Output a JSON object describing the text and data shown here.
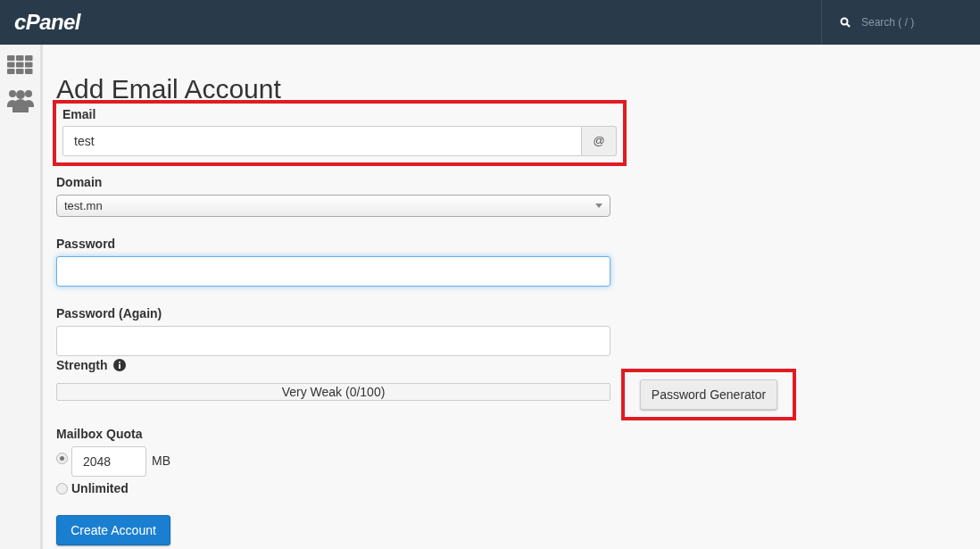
{
  "header": {
    "logo": "cPanel",
    "search": {
      "placeholder": "Search ( / )"
    }
  },
  "page_title": "Add Email Account",
  "email": {
    "label": "Email",
    "value": "test",
    "addon": "@",
    "highlighted": true
  },
  "domain": {
    "label": "Domain",
    "value": "test.mn"
  },
  "password": {
    "label": "Password",
    "focused": true
  },
  "password_again": {
    "label": "Password (Again)",
    "focused": false
  },
  "strength": {
    "label": "Strength",
    "level": 0,
    "reading": "Very Weak (0/100)"
  },
  "password_generator": {
    "label": "Password Generator",
    "highlighted": true
  },
  "mailbox_quota": {
    "label": "Mailbox Quota",
    "options": [
      {
        "kind": "amount",
        "value": "2048",
        "unit": "MB",
        "selected": true
      },
      {
        "kind": "label",
        "label": "Unlimited",
        "selected": false
      }
    ]
  },
  "submit": {
    "label": "Create Account"
  }
}
